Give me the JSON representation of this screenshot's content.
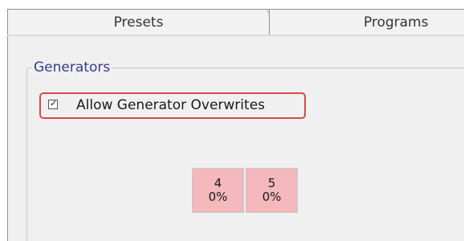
{
  "tabs": [
    {
      "label": "Presets"
    },
    {
      "label": "Programs"
    }
  ],
  "group": {
    "legend": "Generators",
    "allow_overwrites": {
      "label": "Allow Generator Overwrites",
      "checked": true
    }
  },
  "generators": [
    {
      "number": "4",
      "percent": "0%"
    },
    {
      "number": "5",
      "percent": "0%"
    }
  ],
  "colors": {
    "tile_fill": "#f4b8bd",
    "highlight_border": "#d64a4a",
    "legend_text": "#3a3a8c",
    "panel_bg": "#f0f0f0"
  }
}
